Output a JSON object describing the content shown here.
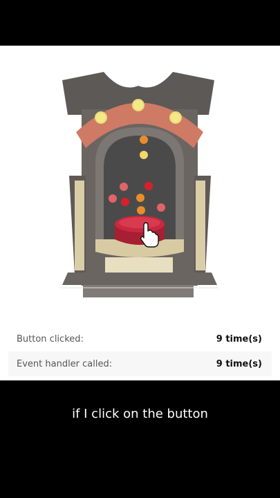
{
  "stats": {
    "rows": [
      {
        "label": "Button clicked:",
        "value": "9 time(s)"
      },
      {
        "label": "Event handler called:",
        "value": "9 time(s)"
      }
    ]
  },
  "caption": "if I click on the button",
  "colors": {
    "button_red": "#c9283e",
    "arch_coral": "#cf7a65",
    "lamp_yellow": "#f4e98a",
    "machine_gray": "#6a6561",
    "base_tan": "#d8cba4"
  }
}
